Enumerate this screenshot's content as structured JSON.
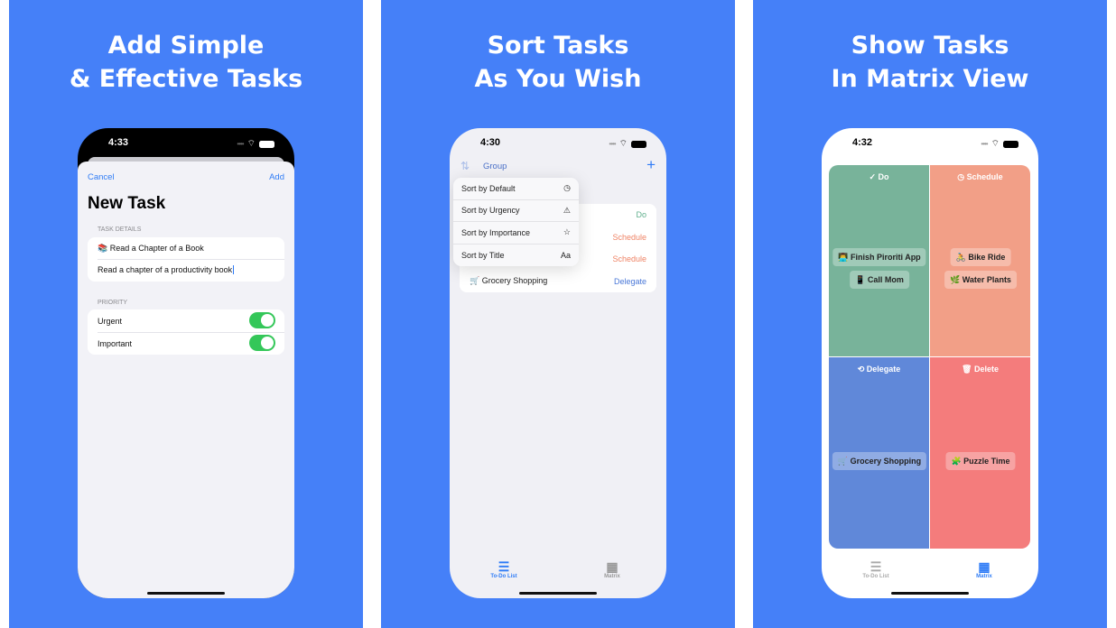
{
  "colors": {
    "background": "#4580f8",
    "accent": "#2f7cf6",
    "do": "#78b39a",
    "schedule": "#f29f87",
    "delegate": "#6088d9",
    "delete": "#f47c7c",
    "toggle": "#34c759"
  },
  "panels": [
    {
      "headline": [
        "Add Simple",
        "& Effective Tasks"
      ],
      "phone": {
        "time": "4:33",
        "cancel": "Cancel",
        "add": "Add",
        "title": "New Task",
        "task_details_label": "TASK DETAILS",
        "task_title": "Read a Chapter of a Book",
        "task_title_emoji": "📚",
        "task_description": "Read a chapter of a productivity book",
        "priority_label": "PRIORITY",
        "priority": [
          {
            "label": "Urgent",
            "on": true
          },
          {
            "label": "Important",
            "on": true
          }
        ]
      }
    },
    {
      "headline": [
        "Sort Tasks",
        "As You Wish"
      ],
      "phone": {
        "time": "4:30",
        "sort_icon": "arrow-up-down-icon",
        "group": "Group",
        "add_icon": "plus-icon",
        "menu": [
          {
            "label": "Sort by Default",
            "icon": "◷"
          },
          {
            "label": "Sort by Urgency",
            "icon": "⚠"
          },
          {
            "label": "Sort by Importance",
            "icon": "☆"
          },
          {
            "label": "Sort by Title",
            "icon": "Aa"
          }
        ],
        "list": [
          {
            "title": "",
            "category": "Do"
          },
          {
            "title": "",
            "category": "Schedule"
          },
          {
            "title": "",
            "category": "Schedule"
          },
          {
            "title": "🛒 Grocery Shopping",
            "category": "Delegate"
          }
        ],
        "tabs": [
          {
            "label": "To-Do List",
            "active": true
          },
          {
            "label": "Matrix",
            "active": false
          }
        ]
      }
    },
    {
      "headline": [
        "Show Tasks",
        "In Matrix View"
      ],
      "phone": {
        "time": "4:32",
        "quadrants": [
          {
            "label": "Do",
            "icon": "✓",
            "tasks": [
              "👨‍💻 Finish Piroriti App",
              "📱 Call Mom"
            ]
          },
          {
            "label": "Schedule",
            "icon": "◷",
            "tasks": [
              "🚴 Bike Ride",
              "🌿 Water Plants"
            ]
          },
          {
            "label": "Delegate",
            "icon": "⟲",
            "tasks": [
              "🛒 Grocery Shopping"
            ]
          },
          {
            "label": "Delete",
            "icon": "🗑",
            "tasks": [
              "🧩 Puzzle Time"
            ]
          }
        ],
        "tabs": [
          {
            "label": "To-Do List",
            "active": false
          },
          {
            "label": "Matrix",
            "active": true
          }
        ]
      }
    }
  ]
}
